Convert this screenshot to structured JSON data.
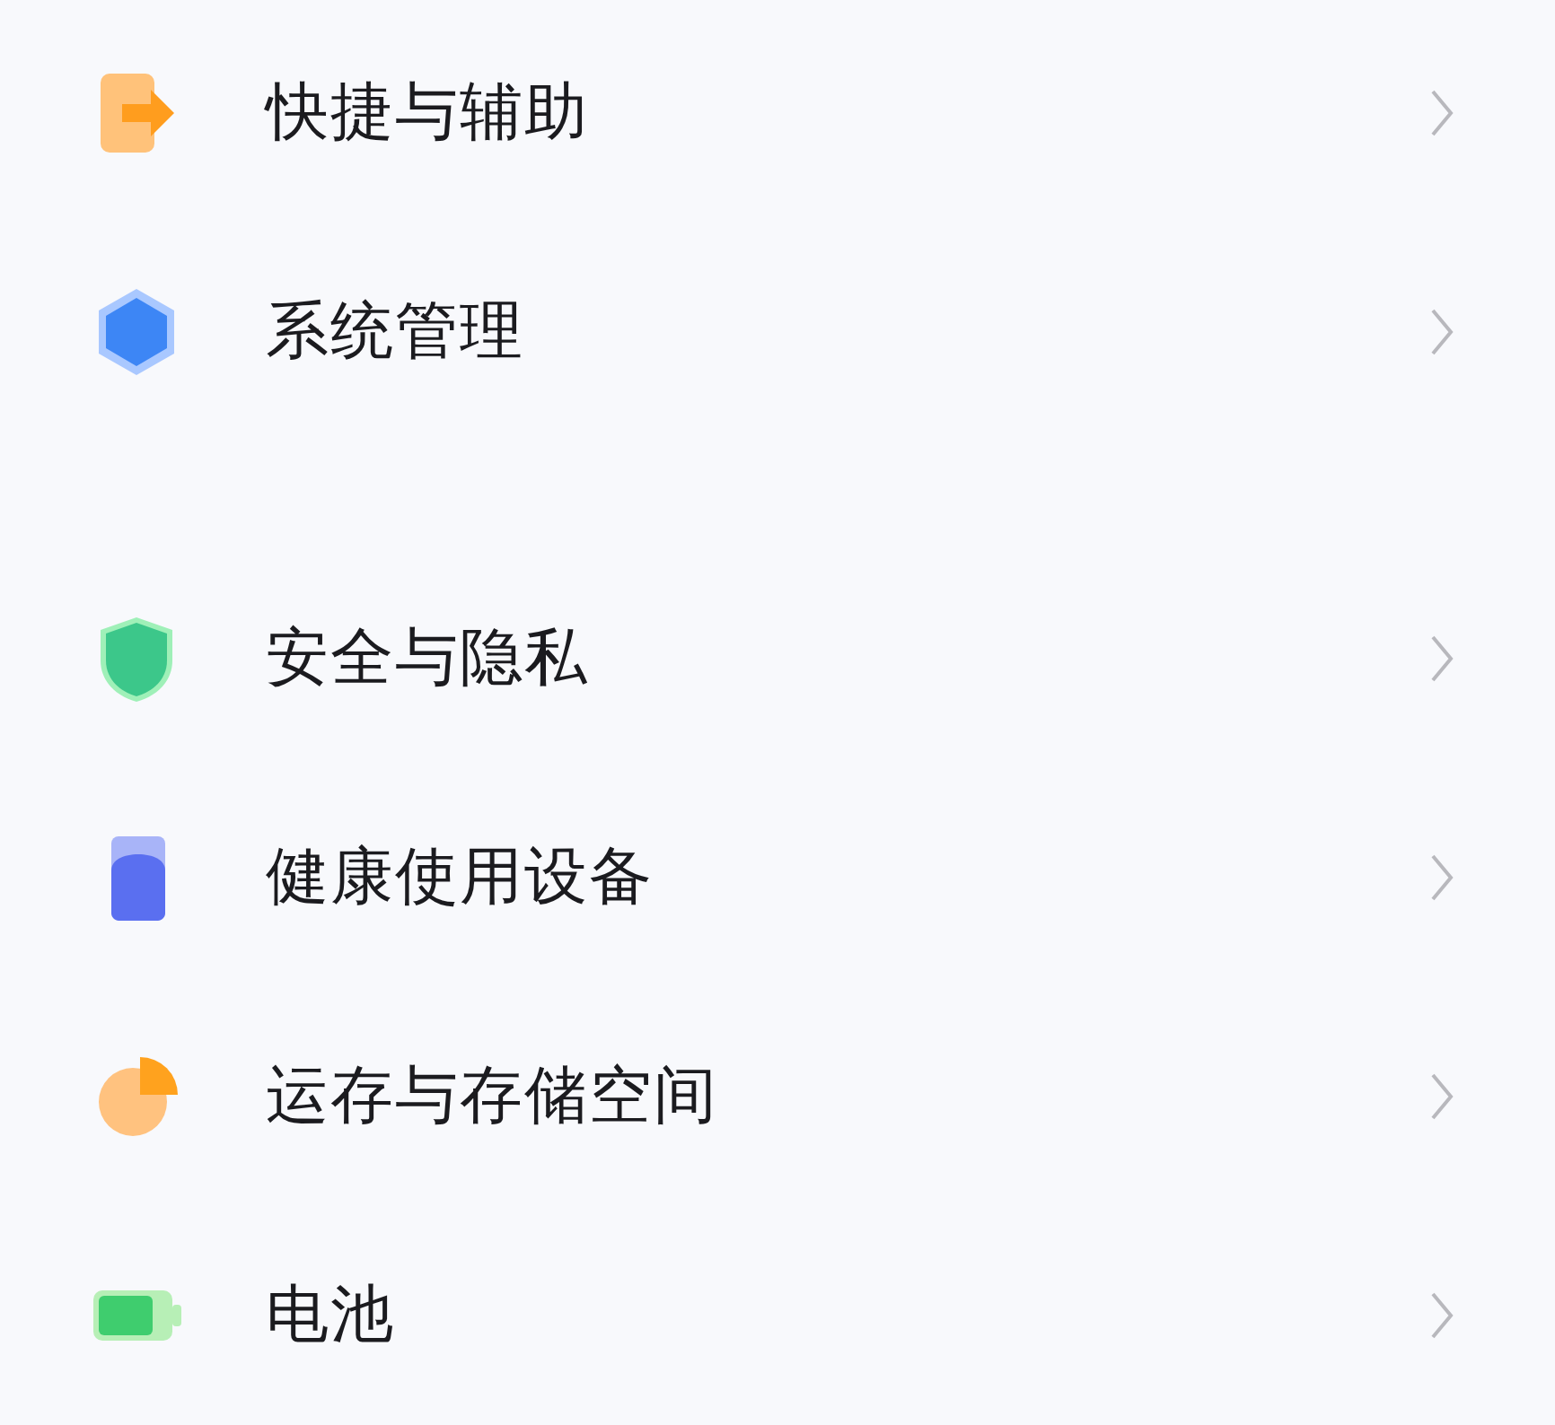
{
  "groups": [
    {
      "items": [
        {
          "label": "快捷与辅助"
        },
        {
          "label": "系统管理"
        }
      ]
    },
    {
      "items": [
        {
          "label": "安全与隐私"
        },
        {
          "label": "健康使用设备"
        },
        {
          "label": "运存与存储空间"
        },
        {
          "label": "电池"
        }
      ]
    }
  ]
}
